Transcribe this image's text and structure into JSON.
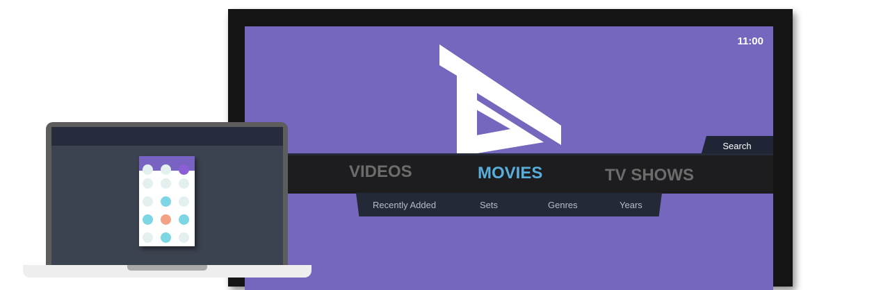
{
  "tv": {
    "clock": "11:00",
    "logo_icon": "kodi-a-logo-icon",
    "search_label": "Search",
    "nav": [
      {
        "label": "VIDEOS",
        "active": false
      },
      {
        "label": "MOVIES",
        "active": true
      },
      {
        "label": "TV SHOWS",
        "active": false
      }
    ],
    "subnav": [
      "Recently Added",
      "Sets",
      "Genres",
      "Years"
    ]
  },
  "laptop": {
    "phone_grid_colors": [
      [
        "#e4f0f0",
        "#e4f0f0",
        "#8a5fd6"
      ],
      [
        "#e4f0f0",
        "#e4f0f0",
        "#e4f0f0"
      ],
      [
        "#e4f0f0",
        "#7cd6e4",
        "#e4f0f0"
      ],
      [
        "#7cd6e4",
        "#f4a285",
        "#7cd6e4"
      ],
      [
        "#e4f0f0",
        "#7cd6e4",
        "#e4f0f0"
      ]
    ]
  },
  "colors": {
    "tv_background": "#7566be",
    "active_tab": "#5aaedc",
    "inactive_tab": "#6c6c6c",
    "nav_bar": "#1d1d1f",
    "subnav_bar": "#242938"
  }
}
